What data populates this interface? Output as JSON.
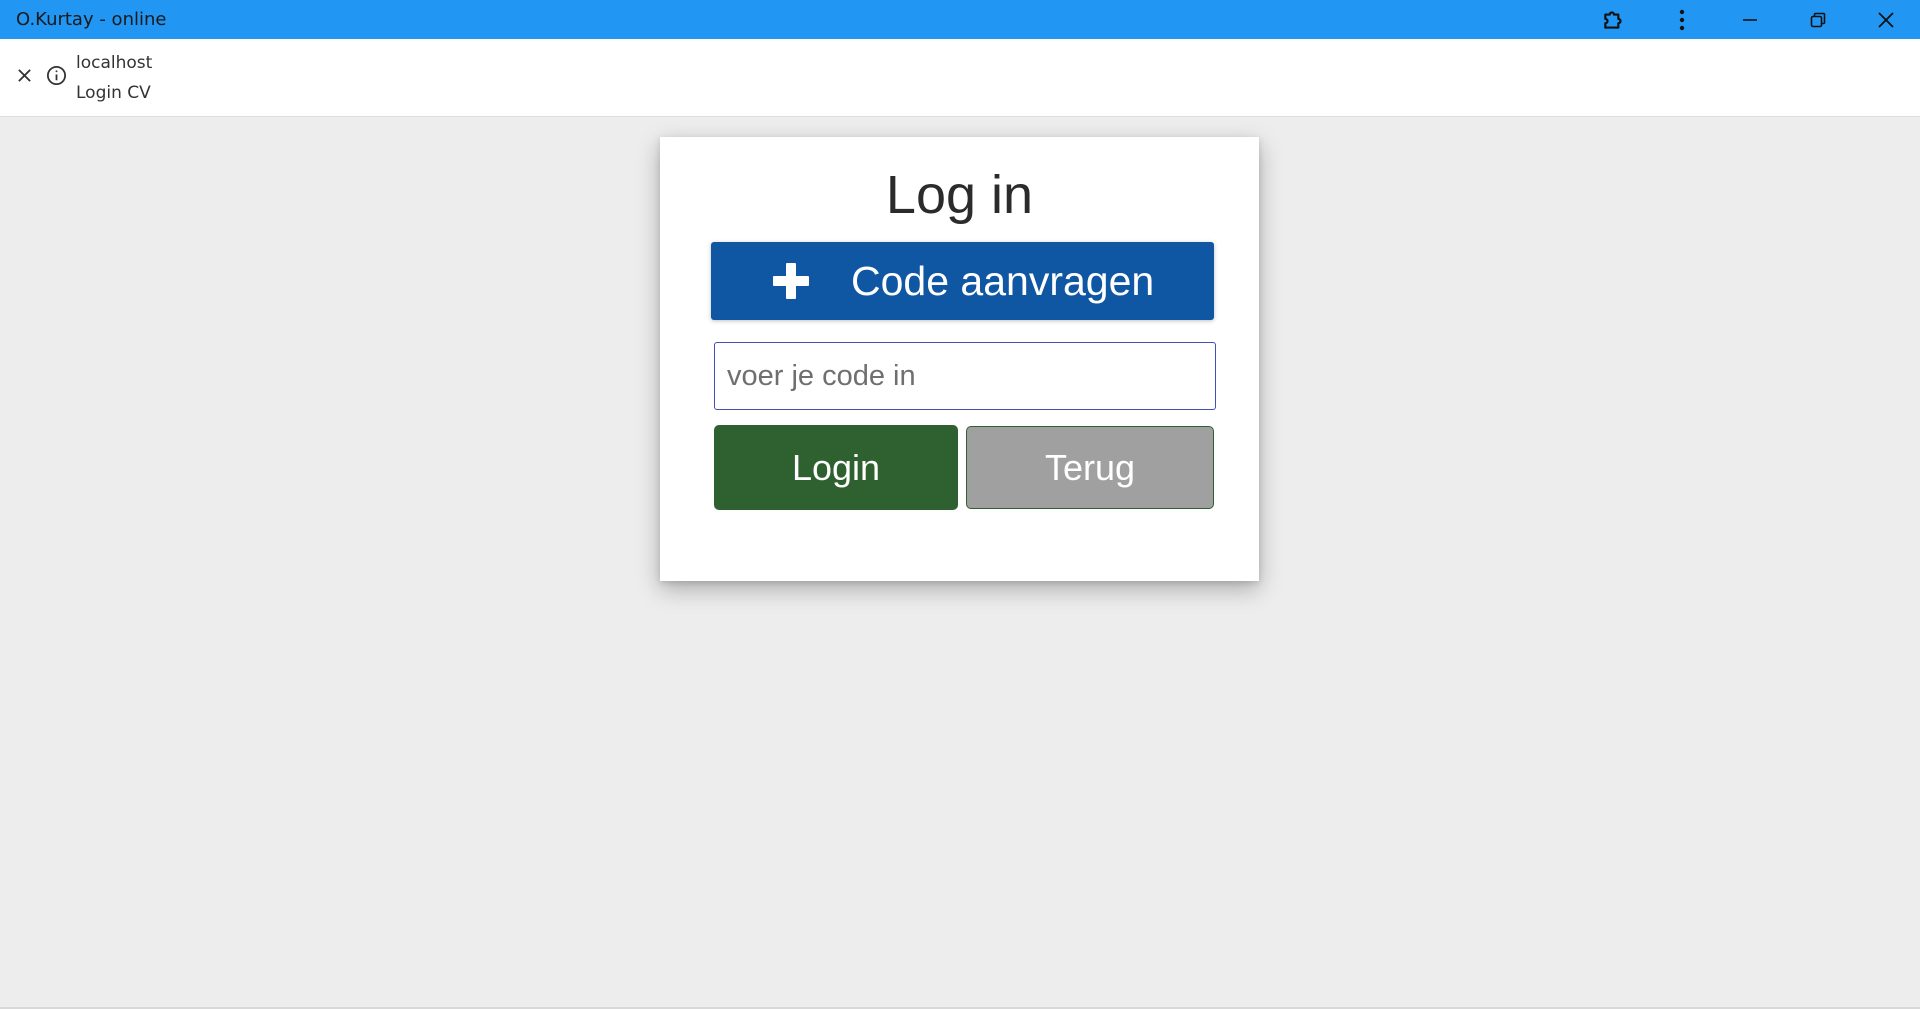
{
  "window": {
    "title": "O.Kurtay - online",
    "controls": {
      "extensions_icon": "puzzle-icon",
      "menu_icon": "more-vert-icon",
      "minimize_icon": "minimize-icon",
      "restore_icon": "restore-icon",
      "close_icon": "close-icon"
    },
    "accent_color": "#2196f3"
  },
  "address_bar": {
    "host": "localhost",
    "page_title": "Login CV"
  },
  "login_card": {
    "heading": "Log in",
    "request_code_label": "Code aanvragen",
    "request_code_icon": "plus-icon",
    "code_input": {
      "placeholder": "voer je code in",
      "value": ""
    },
    "login_label": "Login",
    "back_label": "Terug",
    "colors": {
      "request_button": "#0f56a3",
      "login_button": "#2f6130",
      "back_button": "#a0a0a0"
    }
  }
}
